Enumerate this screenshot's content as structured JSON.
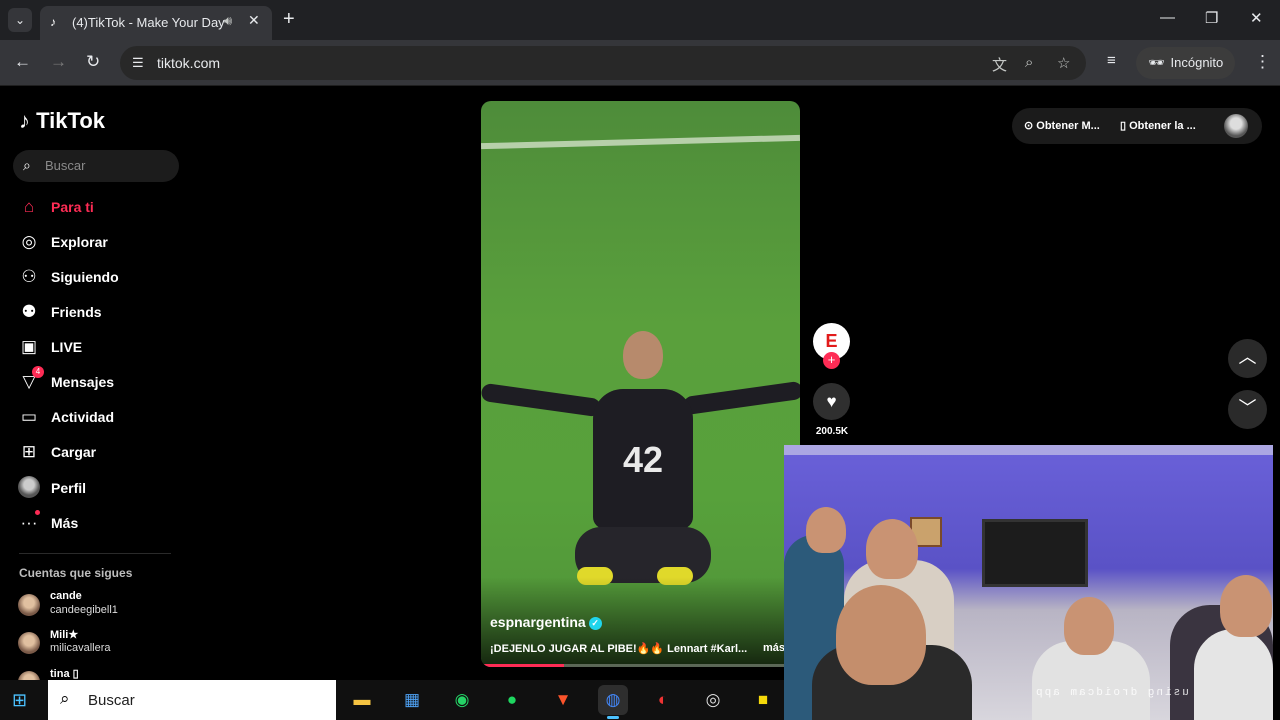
{
  "browser": {
    "tab_title": "(4)TikTok - Make Your Day",
    "url": "tiktok.com",
    "incognito_label": "Incógnito"
  },
  "sidebar": {
    "logo": "TikTok",
    "search_placeholder": "Buscar",
    "items": [
      {
        "label": "Para ti",
        "icon": "home-icon"
      },
      {
        "label": "Explorar",
        "icon": "compass-icon"
      },
      {
        "label": "Siguiendo",
        "icon": "following-icon"
      },
      {
        "label": "Friends",
        "icon": "friends-icon"
      },
      {
        "label": "LIVE",
        "icon": "live-icon"
      },
      {
        "label": "Mensajes",
        "icon": "messages-icon",
        "badge": "4"
      },
      {
        "label": "Actividad",
        "icon": "activity-icon"
      },
      {
        "label": "Cargar",
        "icon": "upload-icon"
      },
      {
        "label": "Perfil",
        "icon": "avatar-icon"
      },
      {
        "label": "Más",
        "icon": "more-icon"
      }
    ],
    "following_title": "Cuentas que sigues",
    "following": [
      {
        "name": "cande",
        "user": "candeegibell1"
      },
      {
        "name": "Mili★",
        "user": "milicavallera"
      },
      {
        "name": "tina ▯",
        "user": ""
      }
    ]
  },
  "video": {
    "author": "espnargentina",
    "caption": "¡DEJENLO JUGAR AL PIBE!🔥🔥 Lennart #Karl...",
    "more": "más",
    "jersey_number": "42",
    "progress": 0.26
  },
  "actions": {
    "avatar_letter": "E",
    "like_count": "200.5K"
  },
  "top_right": {
    "item1": "Obtener M...",
    "item2": "Obtener la ..."
  },
  "webcam": {
    "caption": "using droidcam app"
  },
  "taskbar": {
    "search_placeholder": "Buscar"
  },
  "colors": {
    "accent": "#fe2c55",
    "verified": "#20d5ec"
  }
}
